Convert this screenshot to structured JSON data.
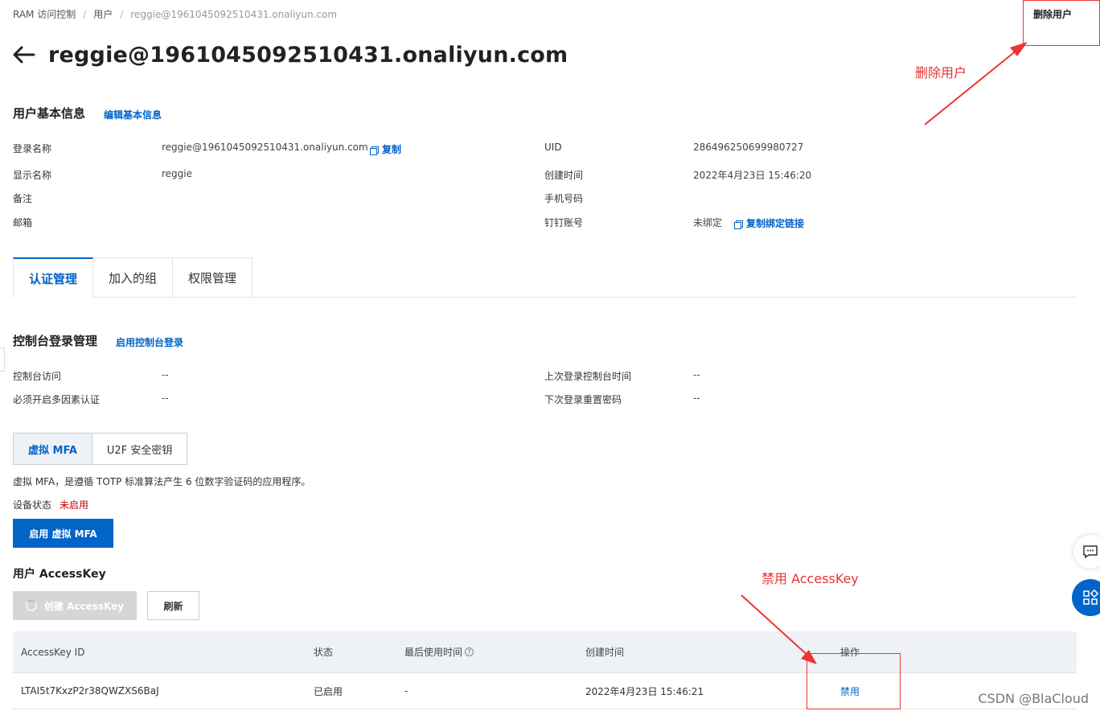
{
  "breadcrumb": [
    "RAM 访问控制",
    "用户",
    "reggie@1961045092510431.onaliyun.com"
  ],
  "header": {
    "title": "reggie@1961045092510431.onaliyun.com",
    "delete_user": "删除用户"
  },
  "basic_info": {
    "title": "用户基本信息",
    "edit_link": "编辑基本信息",
    "left": [
      {
        "label": "登录名称",
        "value": "reggie@1961045092510431.onaliyun.com",
        "action": "复制"
      },
      {
        "label": "显示名称",
        "value": "reggie"
      },
      {
        "label": "备注",
        "value": ""
      },
      {
        "label": "邮箱",
        "value": ""
      }
    ],
    "right": [
      {
        "label": "UID",
        "value": "286496250699980727"
      },
      {
        "label": "创建时间",
        "value": "2022年4月23日 15:46:20"
      },
      {
        "label": "手机号码",
        "value": ""
      },
      {
        "label": "钉钉账号",
        "value": "未绑定",
        "action": "复制绑定链接"
      }
    ]
  },
  "tabs": [
    "认证管理",
    "加入的组",
    "权限管理"
  ],
  "console_login": {
    "title": "控制台登录管理",
    "link": "启用控制台登录",
    "rows": [
      {
        "label": "控制台访问",
        "value": "--",
        "label2": "上次登录控制台时间",
        "value2": "--"
      },
      {
        "label": "必须开启多因素认证",
        "value": "--",
        "label2": "下次登录重置密码",
        "value2": "--"
      }
    ]
  },
  "mfa": {
    "options": [
      "虚拟 MFA",
      "U2F 安全密钥"
    ],
    "description": "虚拟 MFA，是遵循 TOTP 标准算法产生 6 位数字验证码的应用程序。",
    "status_label": "设备状态",
    "status_value": "未启用",
    "enable_button": "启用 虚拟 MFA"
  },
  "accesskey": {
    "title": "用户 AccessKey",
    "create_button": "创建 AccessKey",
    "refresh_button": "刷新",
    "columns": [
      "AccessKey ID",
      "状态",
      "最后使用时间",
      "创建时间",
      "操作"
    ],
    "rows": [
      {
        "id": "LTAI5t7KxzP2r38QWZXS6BaJ",
        "status": "已启用",
        "last_used": "-",
        "created": "2022年4月23日 15:46:21",
        "action": "禁用"
      }
    ]
  },
  "annotations": {
    "delete_user": "删除用户",
    "disable_accesskey": "禁用 AccessKey"
  },
  "colors": {
    "accent": "#0064c8",
    "annotation": "#e53333"
  },
  "watermark": "CSDN @BlaCloud"
}
